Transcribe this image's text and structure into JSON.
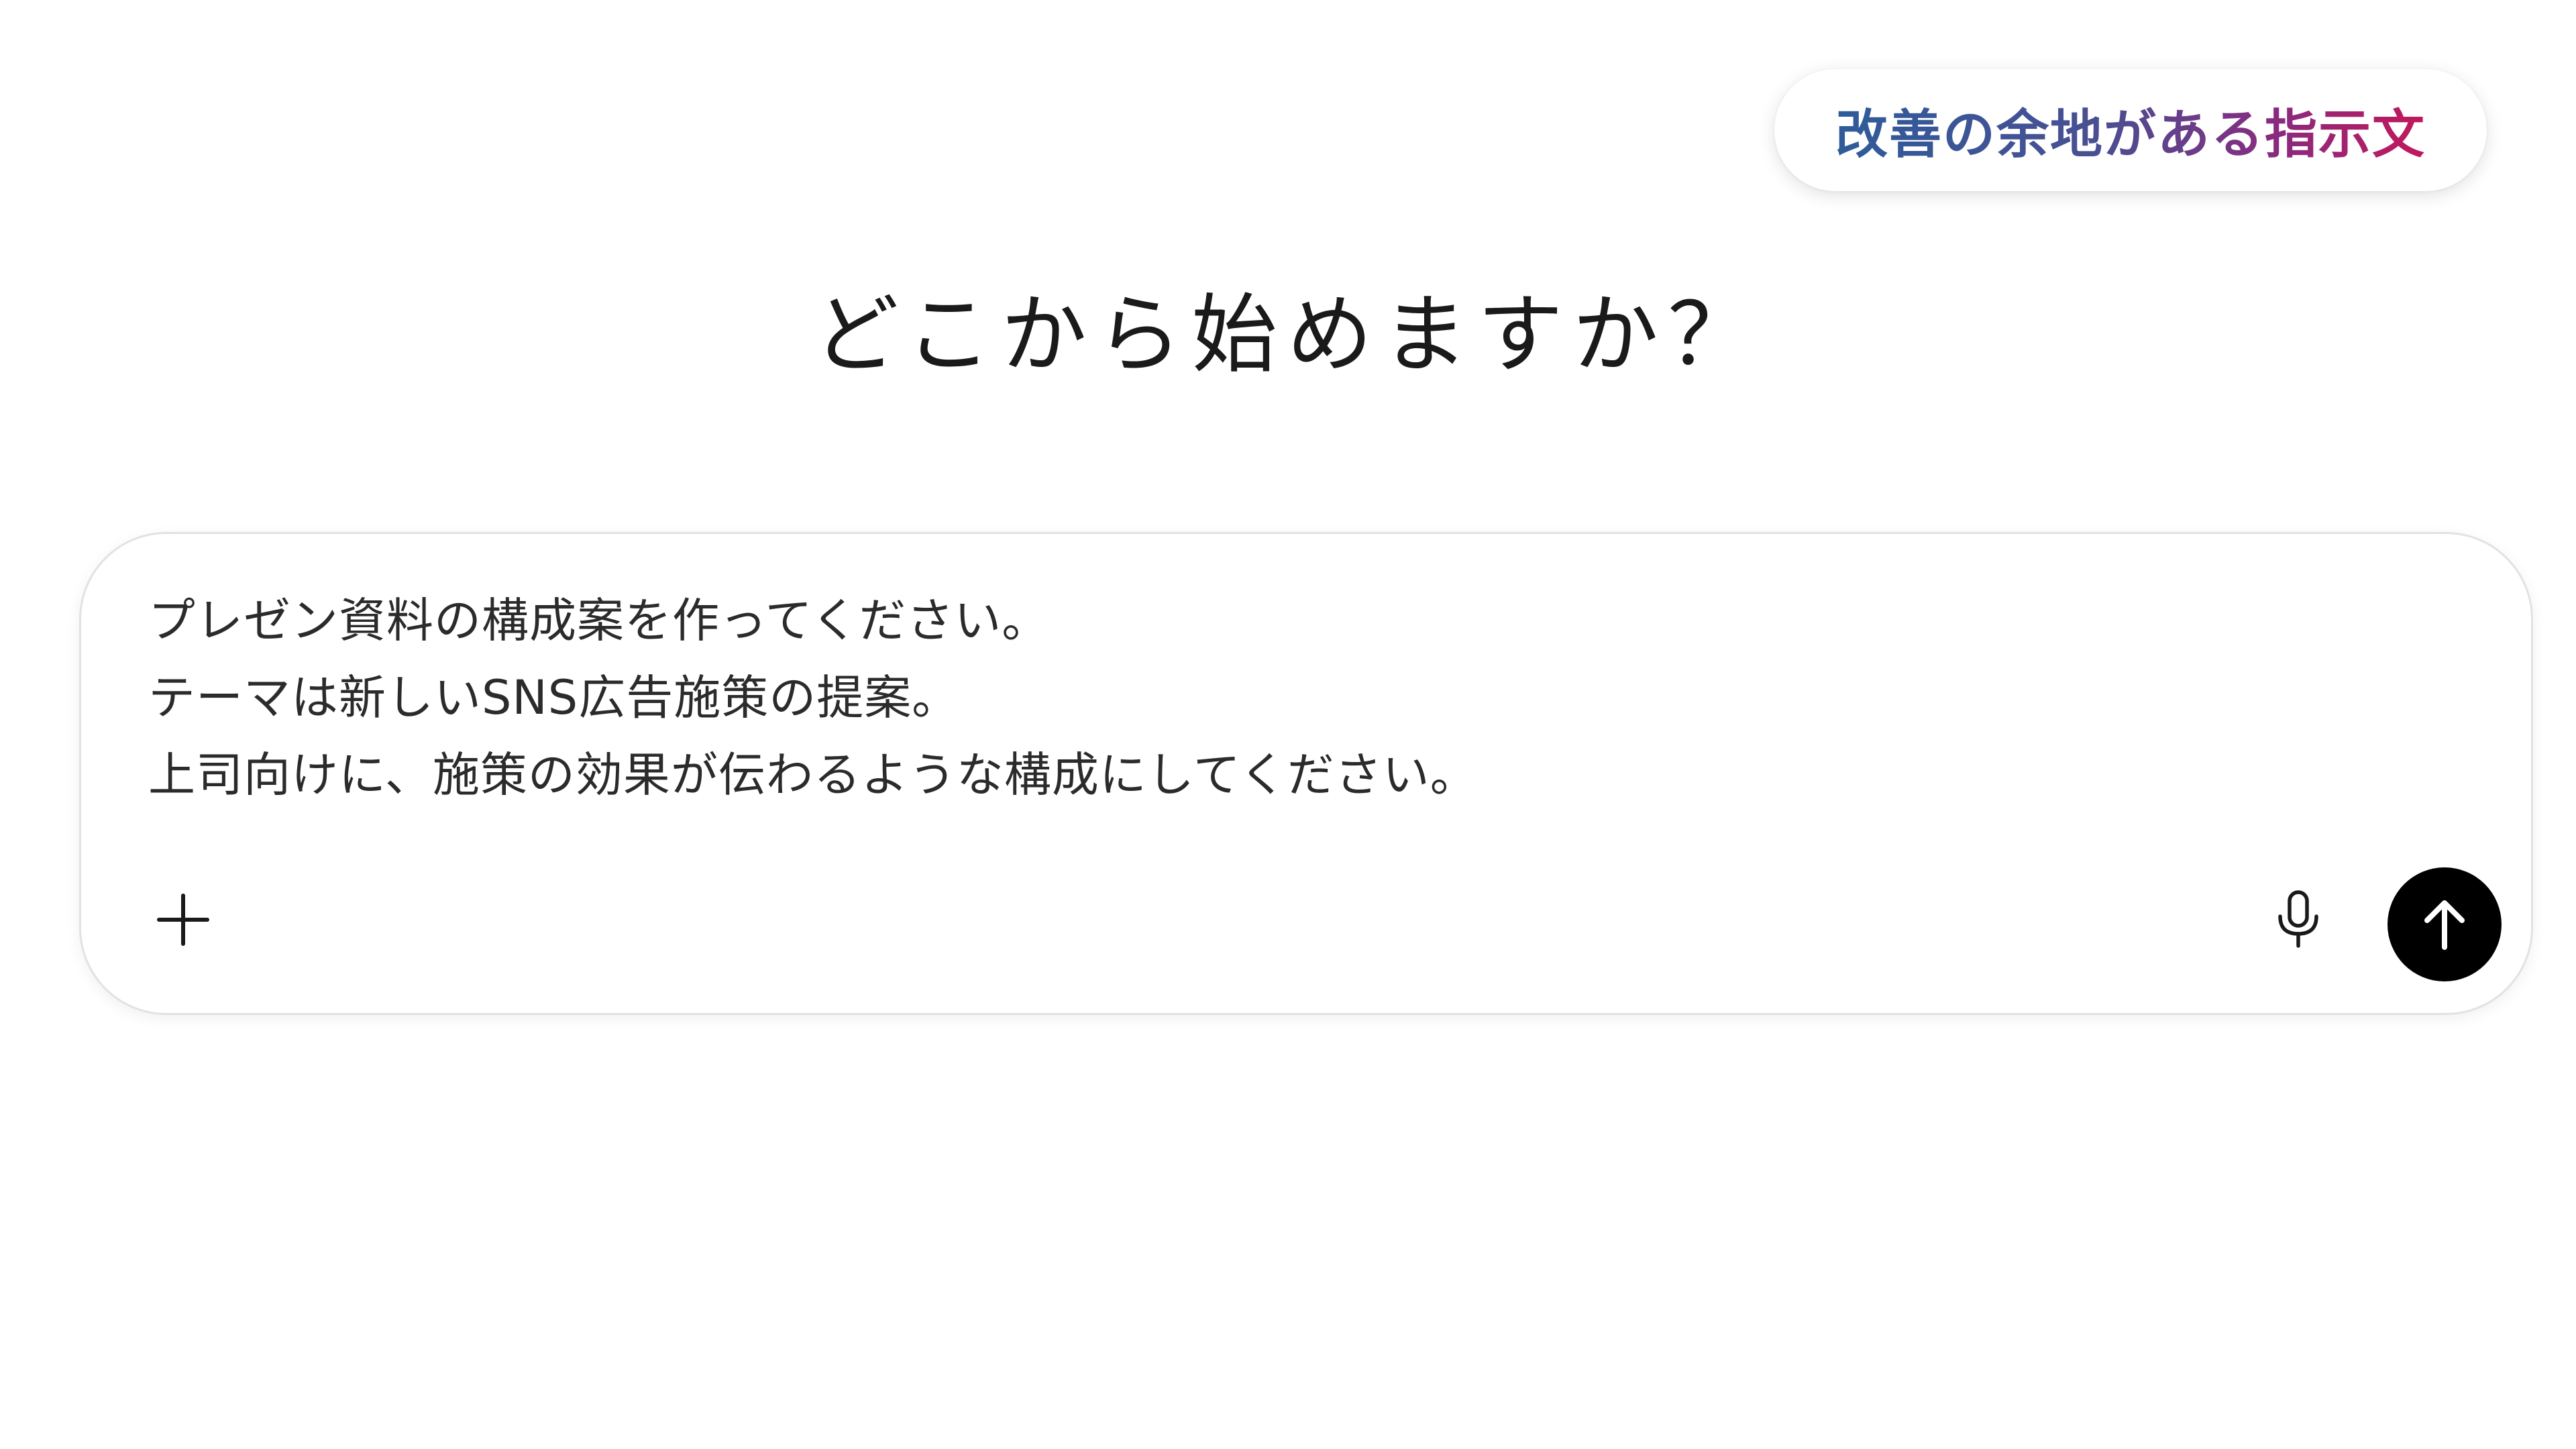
{
  "badge": {
    "label": "改善の余地がある指示文",
    "gradient_colors": [
      "#2f5b9a",
      "#4a4f92",
      "#8a2a7e",
      "#c2185b"
    ]
  },
  "heading": {
    "text": "どこから始めますか？"
  },
  "composer": {
    "prompt_lines": [
      "プレゼン資料の構成案を作ってください。",
      "テーマは新しいSNS広告施策の提案。",
      "上司向けに、施策の効果が伝わるような構成にしてください。"
    ],
    "add_icon": "plus-icon",
    "mic_icon": "microphone-icon",
    "send_icon": "arrow-up-icon"
  }
}
